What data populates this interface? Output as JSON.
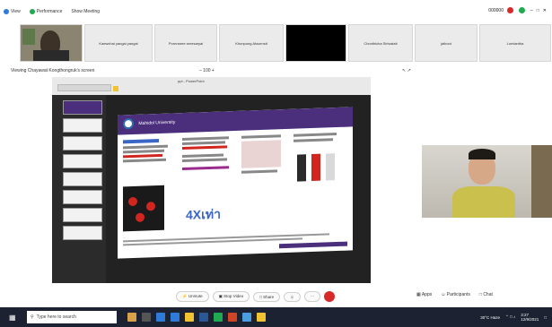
{
  "topbar": {
    "items": [
      "View",
      "Performance",
      "Show Meeting"
    ],
    "right_text": "000000"
  },
  "thumbnails": [
    {
      "label": ""
    },
    {
      "label": "Kaewchai yangai yangai"
    },
    {
      "label": "Pornnaree seresaryai"
    },
    {
      "label": "Khunpong Aksornsit"
    },
    {
      "label": ""
    },
    {
      "label": "Chonthicha Sirisaksit"
    },
    {
      "label": "jaiboot"
    },
    {
      "label": "Lomiantha"
    }
  ],
  "sharebar": {
    "title": "Viewing Chayawat Kongthongruk's screen",
    "zoom": "100",
    "right_glyphs": "↖ ↗"
  },
  "ppt": {
    "file_name": "ppt - PowerPoint"
  },
  "slide": {
    "header_title": "Mahidol University",
    "big_text": "4Xเท่า",
    "footer_text": "..."
  },
  "toolbar": {
    "unmute": "Unmute",
    "stop_video": "Stop Video",
    "share": "Share",
    "end": ""
  },
  "right_buttons": {
    "apps": "Apps",
    "participants": "Participants",
    "chat": "Chat"
  },
  "taskbar": {
    "search_placeholder": "Type here to search",
    "tray_text": "30°C Haze",
    "time": "3:27",
    "date": "12/9/2021"
  }
}
